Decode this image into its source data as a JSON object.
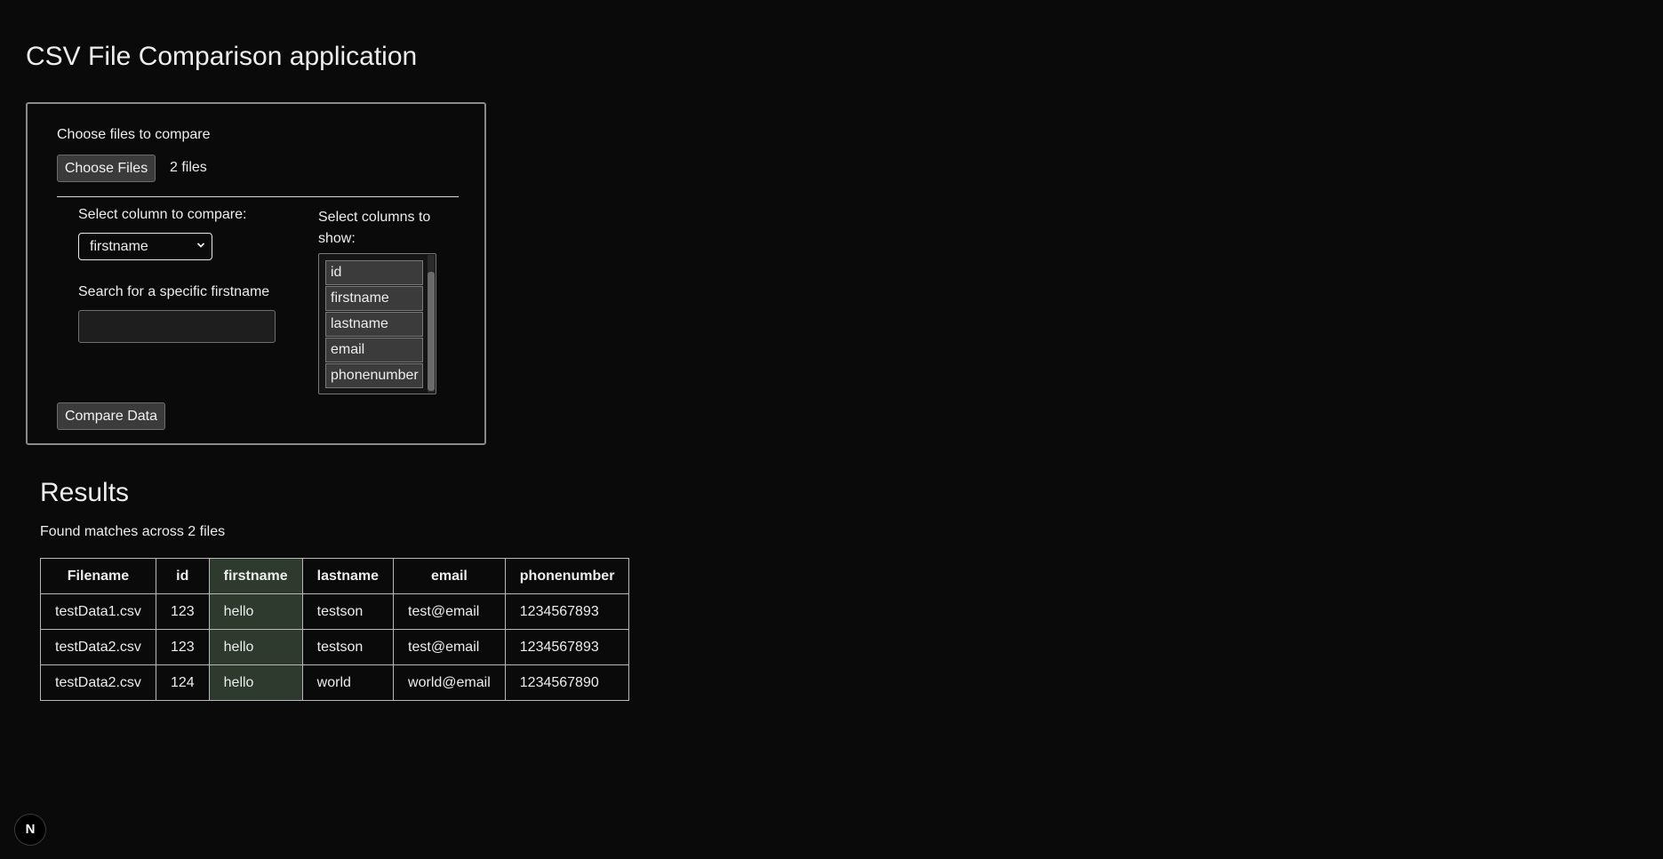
{
  "app": {
    "title": "CSV File Comparison application"
  },
  "upload": {
    "label": "Choose files to compare",
    "button_label": "Choose Files",
    "files_status": "2 files"
  },
  "compare_column": {
    "label": "Select column to compare:",
    "selected": "firstname"
  },
  "search": {
    "label": "Search for a specific firstname",
    "value": "",
    "placeholder": ""
  },
  "show_columns": {
    "label": "Select columns to show:",
    "options": [
      "id",
      "firstname",
      "lastname",
      "email",
      "phonenumber"
    ]
  },
  "compare_button": {
    "label": "Compare Data"
  },
  "results": {
    "title": "Results",
    "summary": "Found matches across 2 files",
    "headers": [
      "Filename",
      "id",
      "firstname",
      "lastname",
      "email",
      "phonenumber"
    ],
    "highlight_column": "firstname",
    "highlight_color": "#2d3a2d",
    "rows": [
      [
        "testData1.csv",
        "123",
        "hello",
        "testson",
        "test@email",
        "1234567893"
      ],
      [
        "testData2.csv",
        "123",
        "hello",
        "testson",
        "test@email",
        "1234567893"
      ],
      [
        "testData2.csv",
        "124",
        "hello",
        "world",
        "world@email",
        "1234567890"
      ]
    ]
  },
  "dev_badge": {
    "label": "N",
    "icon": "nextjs-icon"
  }
}
